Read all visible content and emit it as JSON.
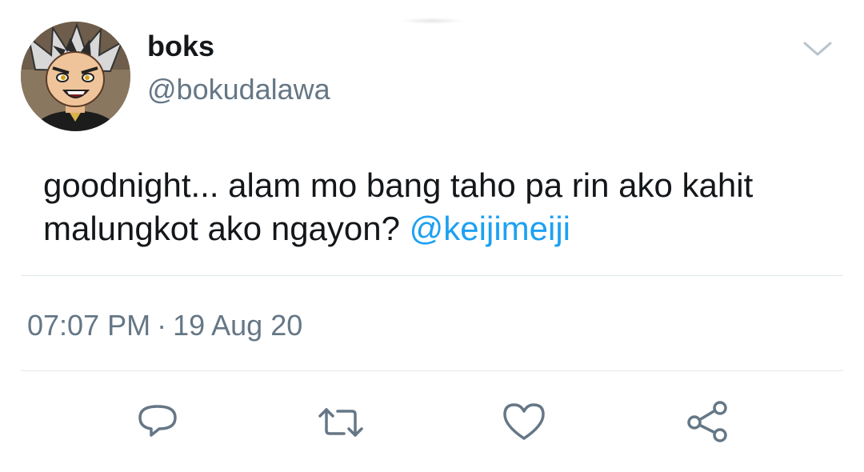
{
  "tweet": {
    "display_name": "boks",
    "handle": "@bokudalawa",
    "text": "goodnight... alam mo bang taho pa rin ako kahit malungkot ako ngayon?",
    "mention": "@keijimeiji",
    "time": "07:07 PM",
    "separator": "·",
    "date": "19 Aug 20"
  },
  "icons": {
    "menu": "chevron-down-icon",
    "reply": "reply-icon",
    "retweet": "retweet-icon",
    "like": "heart-icon",
    "share": "share-icon"
  },
  "colors": {
    "text": "#14171a",
    "secondary": "#657786",
    "link": "#1da1f2",
    "divider": "#e1e8ed",
    "icon": "#657786"
  }
}
